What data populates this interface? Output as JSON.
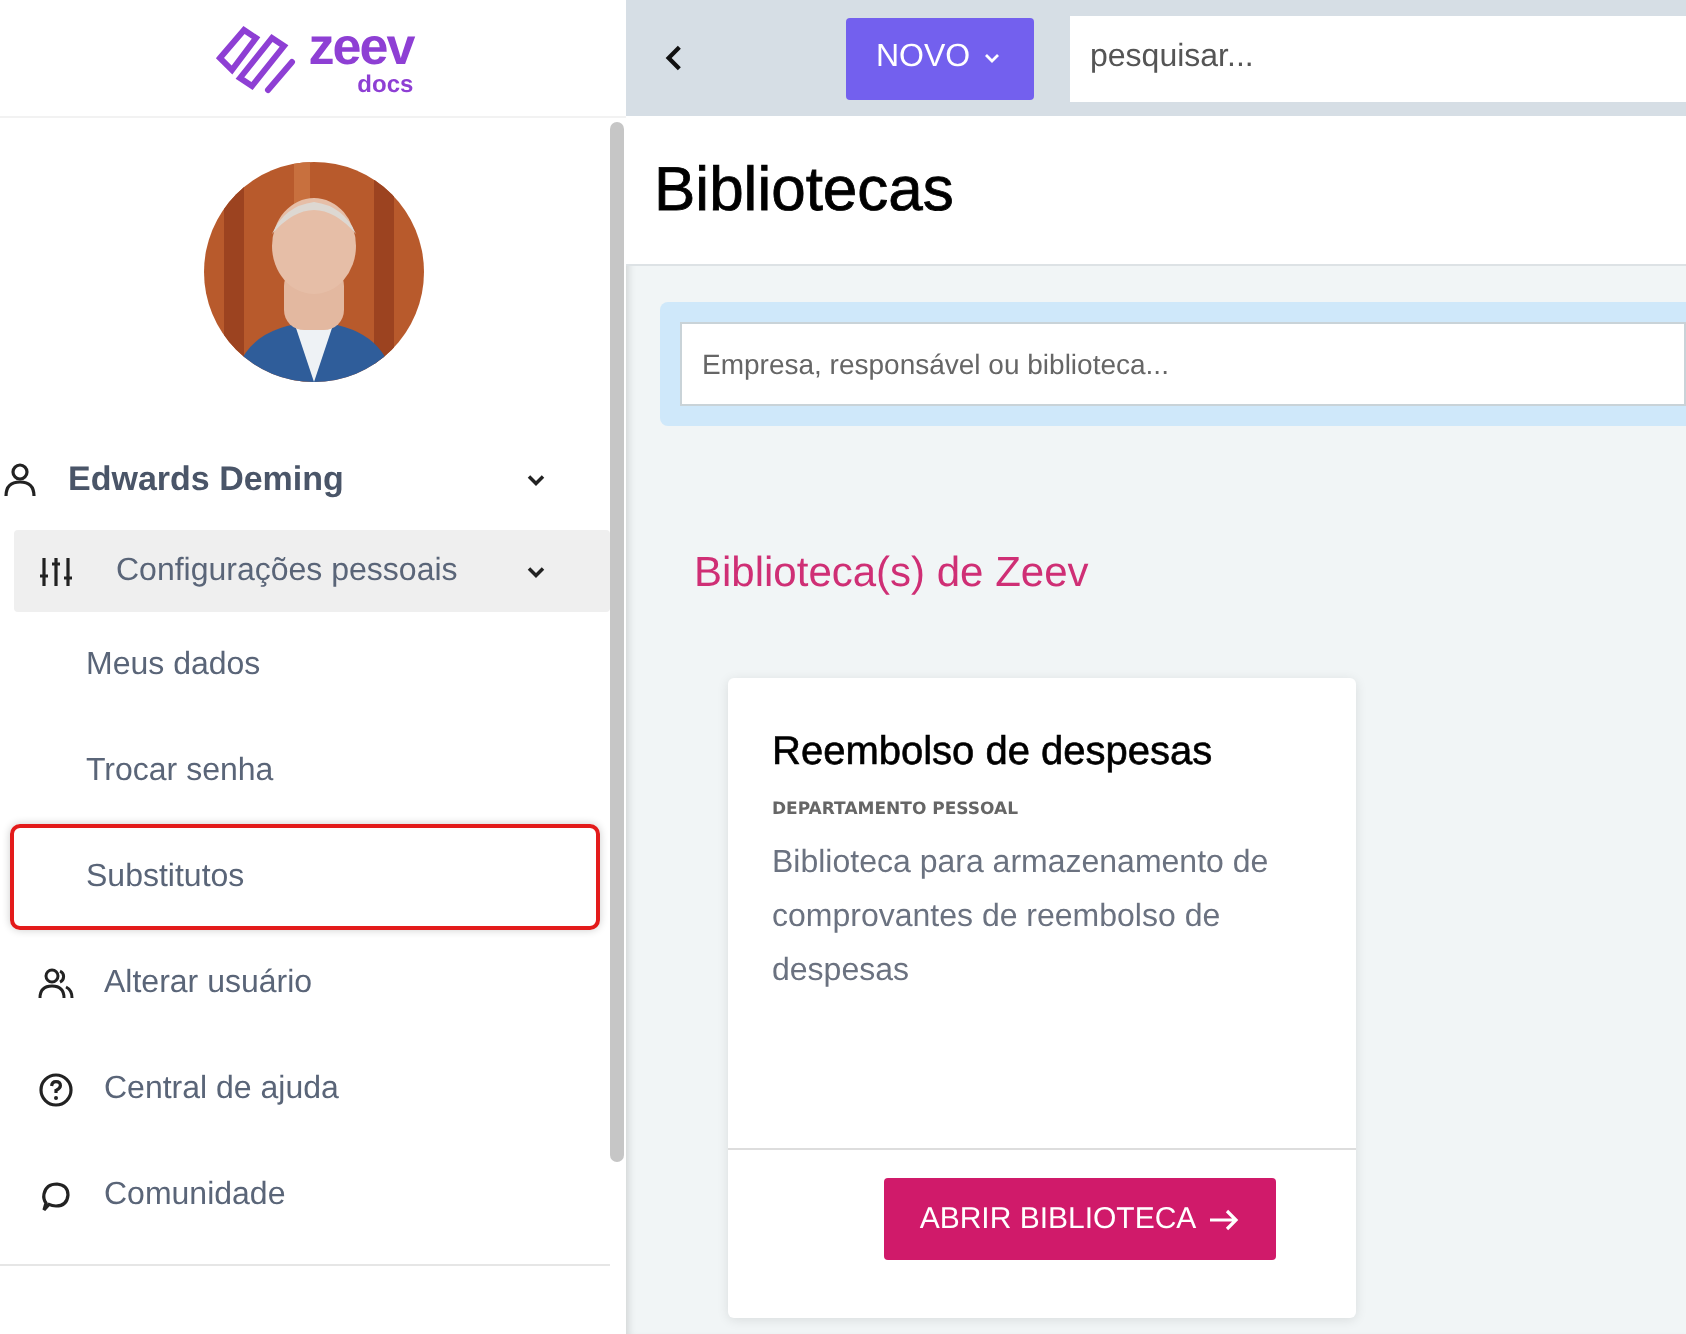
{
  "logo": {
    "word": "zeev",
    "sub": "docs"
  },
  "user": {
    "name": "Edwards Deming",
    "expanded": true
  },
  "menu": [
    {
      "kind": "settings",
      "label": "Configurações pessoais",
      "expanded": true,
      "children": [
        {
          "label": "Meus dados",
          "highlighted": false
        },
        {
          "label": "Trocar senha",
          "highlighted": false
        },
        {
          "label": "Substitutos",
          "highlighted": true
        }
      ]
    },
    {
      "kind": "users",
      "label": "Alterar usuário"
    },
    {
      "kind": "help",
      "label": "Central de ajuda"
    },
    {
      "kind": "chat",
      "label": "Comunidade"
    }
  ],
  "topbar": {
    "new_button": "NOVO",
    "search": {
      "placeholder": "pesquisar..."
    }
  },
  "page_title": "Bibliotecas",
  "filter": {
    "placeholder": "Empresa, responsável ou biblioteca..."
  },
  "section_title": "Biblioteca(s) de Zeev",
  "cards": [
    {
      "title": "Reembolso de despesas",
      "department": "DEPARTAMENTO PESSOAL",
      "description": "Biblioteca para armazenamento de comprovantes de reembolso de despesas",
      "button": "ABRIR BIBLIOTECA"
    }
  ]
}
